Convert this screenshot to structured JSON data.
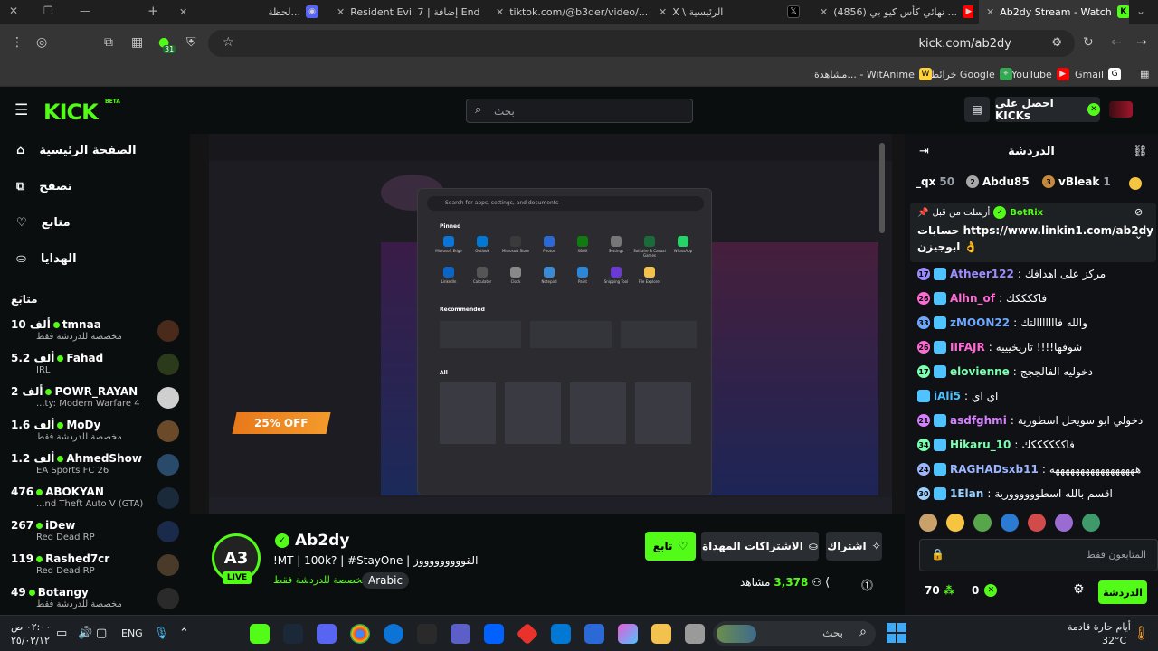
{
  "browser": {
    "tabs": [
      {
        "title": "لحظة...",
        "icon": "discord-icon",
        "color": "#5865F2"
      },
      {
        "title": "Resident Evil 7 | إضافة End",
        "icon": "youtube-icon",
        "color": "#ff0000"
      },
      {
        "title": "tiktok.com/@b3der/video/...",
        "icon": "tiktok-icon",
        "color": "#000000"
      },
      {
        "title": "X \\ الرئيسية",
        "icon": "x-icon",
        "color": "#000000"
      },
      {
        "title": "(4856) نهائي كأس كيو بي ...",
        "icon": "youtube-icon",
        "color": "#ff0000"
      },
      {
        "title": "Ab2dy Stream - Watch",
        "icon": "kick-icon",
        "color": "#53fc18"
      }
    ],
    "url": "kick.com/ab2dy",
    "extension_badge": "31",
    "bookmarks": [
      {
        "label": "Gmail",
        "icon": "google-icon"
      },
      {
        "label": "YouTube",
        "icon": "youtube-icon"
      },
      {
        "label": "خرائط Google",
        "icon": "maps-icon"
      },
      {
        "label": "مشاهدة... - WitAnime",
        "icon": "witanime-icon"
      }
    ]
  },
  "kick": {
    "logo": "KICK",
    "beta": "BETA",
    "search_placeholder": "بحث",
    "get_kicks": "احصل على KICKs",
    "nav": [
      {
        "label": "الصفحة الرئيسية",
        "icon": "home-icon"
      },
      {
        "label": "تصفح",
        "icon": "browse-icon"
      },
      {
        "label": "متابع",
        "icon": "heart-icon"
      },
      {
        "label": "الهدايا",
        "icon": "gift-icon"
      }
    ],
    "following_title": "متابَع",
    "following": [
      {
        "name": "tmnaa",
        "viewers": "10 ألف",
        "category": "مخصصة للدردشة فقط"
      },
      {
        "name": "Fahad",
        "viewers": "5.2 ألف",
        "category": "IRL"
      },
      {
        "name": "POWR_RAYAN",
        "viewers": "2 ألف",
        "category": "...ty: Modern Warfare 4"
      },
      {
        "name": "MoDy",
        "viewers": "1.6 ألف",
        "category": "مخصصة للدردشة فقط"
      },
      {
        "name": "AhmedShow",
        "viewers": "1.2 ألف",
        "category": "EA Sports FC 26"
      },
      {
        "name": "ABOKYAN",
        "viewers": "476",
        "category": "...nd Theft Auto V (GTA)"
      },
      {
        "name": "iDew",
        "viewers": "267",
        "category": "Red Dead RP"
      },
      {
        "name": "Rashed7cr",
        "viewers": "119",
        "category": "Red Dead RP"
      },
      {
        "name": "Botangy",
        "viewers": "49",
        "category": "مخصصة للدردشة فقط"
      }
    ]
  },
  "player": {
    "offer": "25% OFF",
    "start_search": "Search for apps, settings, and documents",
    "pinned_label": "Pinned",
    "recommended_label": "Recommended",
    "all_label": "All",
    "pinned_apps": [
      "Microsoft Edge",
      "Outlook",
      "Microsoft Store",
      "Photos",
      "XBOX",
      "Settings",
      "Solitaire & Casual Games",
      "WhatsApp",
      "LinkedIn",
      "Calculator",
      "Clock",
      "Notepad",
      "Paint",
      "Snipping Tool",
      "File Explorer"
    ]
  },
  "stream": {
    "avatar_text": "A3",
    "live": "LIVE",
    "channel": "Ab2dy",
    "title": "!MT | 100k? | #StayOne | القوووووووووز",
    "category": "مخصصة للدردشة فقط",
    "language": "Arabic",
    "viewers": "3,378",
    "viewers_label": "مشاهد",
    "follow": "تابع",
    "gift_subs": "الاشتراكات المهداة",
    "subscribe": "اشتراك"
  },
  "chat": {
    "title": "الدردشة",
    "leaders": [
      {
        "name": "vBleak",
        "count": "1",
        "rank": "3"
      },
      {
        "name": "Abdu85",
        "count": "",
        "rank": "2"
      },
      {
        "name": "_qx",
        "count": "50",
        "rank": ""
      }
    ],
    "pinned_user": "BotRix",
    "pinned_label": "أرسلت من قبل",
    "pinned_text": "حسابات https://www.linkin1.com/ab2dy",
    "pinned_text2": "ابوجيزن 👌",
    "messages": [
      {
        "badge": "17",
        "user": "Atheer122",
        "color": "#9b8cff",
        "text": "مركز على اهدافك"
      },
      {
        "badge": "26",
        "user": "Alhn_of",
        "color": "#ff6ad5",
        "text": "فاككككك"
      },
      {
        "badge": "33",
        "user": "zMOON22",
        "color": "#6ea8ff",
        "text": "والله فااااااالتك"
      },
      {
        "badge": "26",
        "user": "IIFAJR",
        "color": "#ff6ad5",
        "text": "شوفها!!!! تاريخيييه"
      },
      {
        "badge": "17",
        "user": "elovienne",
        "color": "#7bffb0",
        "text": "دخوليه الفالججج"
      },
      {
        "badge": "",
        "user": "iAli5",
        "color": "#4fc3ff",
        "text": "اي اي"
      },
      {
        "badge": "21",
        "user": "asdfghmi",
        "color": "#d580ff",
        "text": "دخولي ابو سويحل اسطورية"
      },
      {
        "badge": "34",
        "user": "Hikaru_10",
        "color": "#7bffb0",
        "text": "فاككككككك"
      },
      {
        "badge": "24",
        "user": "RAGHADsxb11",
        "color": "#9bb6ff",
        "text": "هههههههههههههههههه"
      },
      {
        "badge": "30",
        "user": "1Elan",
        "color": "#9bd1ff",
        "text": "اقسم بالله اسطوووووورية"
      }
    ],
    "input_placeholder": "المتابعون فقط",
    "points": "70",
    "kicks": "0",
    "send": "الدردشة"
  },
  "taskbar": {
    "weather": "أيام حارة قادمة",
    "temp": "32°C",
    "search": "بحث",
    "lang": "ENG",
    "time": "٠٢:٠٠ ص",
    "date": "٢٥/٠٣/١٢"
  }
}
